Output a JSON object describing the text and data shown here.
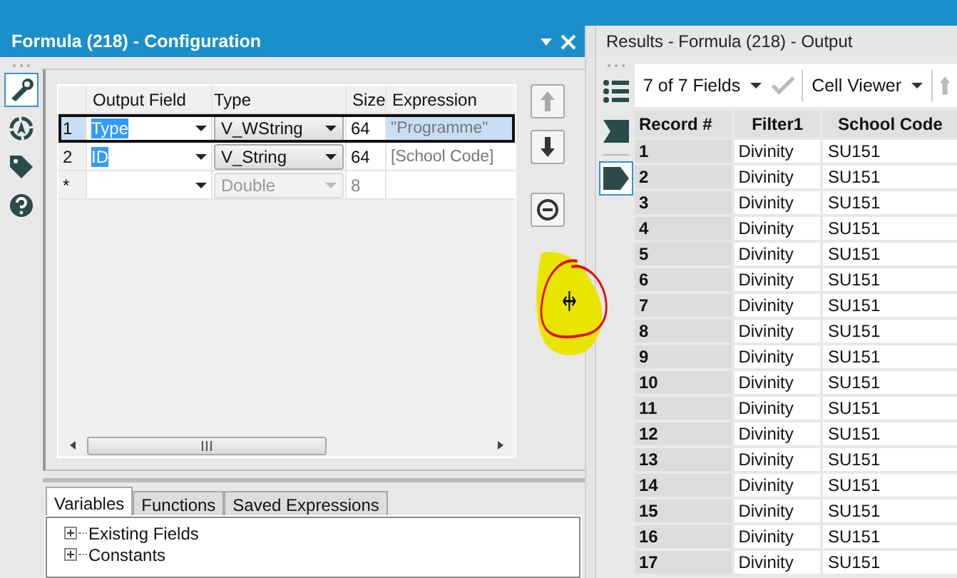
{
  "config_panel": {
    "title": "Formula (218) - Configuration",
    "sidebar": [
      {
        "kind": "wrench",
        "selected": true
      },
      {
        "kind": "compass",
        "selected": false
      },
      {
        "kind": "tag",
        "selected": false
      },
      {
        "kind": "help",
        "selected": false
      }
    ],
    "grid": {
      "columns": [
        "Output Field",
        "Type",
        "Size",
        "Expression"
      ],
      "rows": [
        {
          "row_header": "1",
          "output_field": "Type",
          "type": "V_WString",
          "size": "64",
          "expression": "\"Programme\"",
          "selected": true,
          "kind": "field"
        },
        {
          "row_header": "2",
          "output_field": "ID",
          "type": "V_String",
          "size": "64",
          "expression": "[School  Code]",
          "selected": false,
          "kind": "field"
        },
        {
          "row_header": "*",
          "type": "Double",
          "size": "8",
          "selected": false,
          "kind": "new"
        }
      ]
    },
    "tabs": [
      {
        "label": "Variables",
        "selected": true
      },
      {
        "label": "Functions",
        "selected": false
      },
      {
        "label": "Saved Expressions",
        "selected": false
      }
    ],
    "tree": [
      {
        "label": "Existing Fields",
        "expanded": false
      },
      {
        "label": "Constants",
        "expanded": false
      }
    ]
  },
  "results_panel": {
    "title": "Results - Formula (218) - Output",
    "sidebar": [
      {
        "kind": "list",
        "selected": false
      },
      {
        "kind": "flag",
        "selected": false
      },
      {
        "kind": "tag",
        "selected": true
      }
    ],
    "toolbar": {
      "fields": "7 of 7 Fields",
      "viewer": "Cell Viewer"
    },
    "table": {
      "columns": [
        "Record #",
        "Filter1",
        "School  Code"
      ],
      "rows": [
        [
          "1",
          "Divinity",
          "SU151"
        ],
        [
          "2",
          "Divinity",
          "SU151"
        ],
        [
          "3",
          "Divinity",
          "SU151"
        ],
        [
          "4",
          "Divinity",
          "SU151"
        ],
        [
          "5",
          "Divinity",
          "SU151"
        ],
        [
          "6",
          "Divinity",
          "SU151"
        ],
        [
          "7",
          "Divinity",
          "SU151"
        ],
        [
          "8",
          "Divinity",
          "SU151"
        ],
        [
          "9",
          "Divinity",
          "SU151"
        ],
        [
          "10",
          "Divinity",
          "SU151"
        ],
        [
          "11",
          "Divinity",
          "SU151"
        ],
        [
          "12",
          "Divinity",
          "SU151"
        ],
        [
          "13",
          "Divinity",
          "SU151"
        ],
        [
          "14",
          "Divinity",
          "SU151"
        ],
        [
          "15",
          "Divinity",
          "SU151"
        ],
        [
          "16",
          "Divinity",
          "SU151"
        ],
        [
          "17",
          "Divinity",
          "SU151"
        ]
      ]
    }
  }
}
